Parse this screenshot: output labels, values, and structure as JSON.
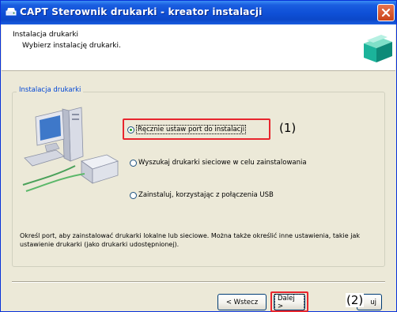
{
  "window": {
    "title": "CAPT Sterownik drukarki - kreator instalacji"
  },
  "header": {
    "title": "Instalacja drukarki",
    "subtitle": "Wybierz instalację drukarki."
  },
  "group": {
    "legend": "Instalacja drukarki"
  },
  "options": [
    {
      "label": "Ręcznie ustaw port do instalacji",
      "selected": true
    },
    {
      "label": "Wyszukaj drukarki sieciowe w celu zainstalowania",
      "selected": false
    },
    {
      "label": "Zainstaluj, korzystając z połączenia USB",
      "selected": false
    }
  ],
  "description": "Określ port, aby zainstalować drukarki lokalne lub sieciowe. Można także określić inne ustawienia, takie jak ustawienie drukarki (jako drukarki udostępnionej).",
  "buttons": {
    "back": "< Wstecz",
    "next": "Dalej >",
    "cancel_partial": "uj"
  },
  "callouts": {
    "one": "(1)",
    "two": "(2)"
  },
  "colors": {
    "titlebar": "#0e4fd6",
    "callout": "#e8262e",
    "legend_text": "#0046d5"
  }
}
